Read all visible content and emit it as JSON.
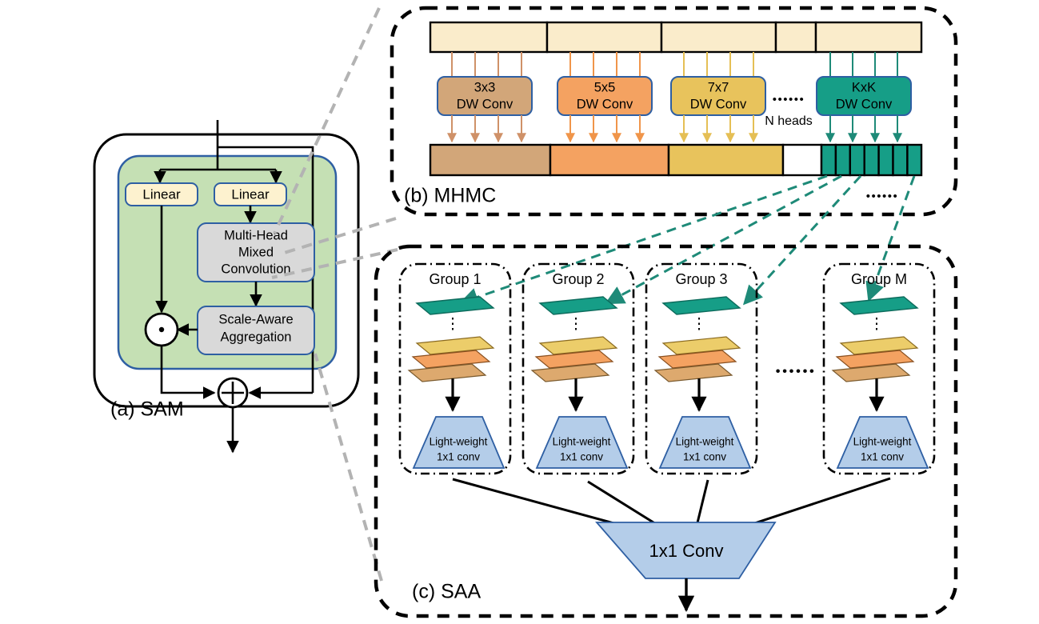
{
  "figure": {
    "title": "Scale-Aware Modulation architecture",
    "panels": [
      {
        "id": "a",
        "label": "(a) SAM"
      },
      {
        "id": "b",
        "label": "(b) MHMC"
      },
      {
        "id": "c",
        "label": "(c) SAA"
      }
    ]
  },
  "panel_a": {
    "label": "(a) SAM",
    "linear_left": "Linear",
    "linear_right": "Linear",
    "mhmc_block": "Multi-Head\nMixed\nConvolution",
    "mhmc_lines": [
      "Multi-Head",
      "Mixed",
      "Convolution"
    ],
    "saa_block": "Scale-Aware\nAggregation",
    "saa_lines": [
      "Scale-Aware",
      "Aggregation"
    ],
    "mul_symbol": "·",
    "add_symbol": "+",
    "colors": {
      "inner_fill": "#c5e0b4",
      "inner_stroke": "#2e5fa3",
      "linear_fill": "#fdf2cf",
      "gray_fill": "#d9d9d9",
      "outline": "#000000"
    }
  },
  "panel_b": {
    "label": "(b) MHMC",
    "heads": [
      {
        "kernel": "3x3",
        "op": "DW Conv",
        "color": "#d2a679"
      },
      {
        "kernel": "5x5",
        "op": "DW Conv",
        "color": "#f4a261"
      },
      {
        "kernel": "7x7",
        "op": "DW Conv",
        "color": "#e8c35c"
      },
      {
        "kernel": "KxK",
        "op": "DW Conv",
        "color": "#169e87"
      }
    ],
    "ellipsis_heads": "••••••",
    "n_heads_label": "N heads",
    "ellipsis_bottom": "••••••",
    "input_fill": "#faeccb",
    "teal_cells": 7,
    "output_segments": [
      {
        "color": "#d2a679"
      },
      {
        "color": "#f4a261"
      },
      {
        "color": "#e8c35c"
      },
      {
        "color": "#ffffff"
      },
      {
        "color": "#169e87"
      }
    ]
  },
  "panel_c": {
    "label": "(c) SAA",
    "groups": [
      {
        "title": "Group 1",
        "conv_line1": "Light-weight",
        "conv_line2": "1x1 conv"
      },
      {
        "title": "Group 2",
        "conv_line1": "Light-weight",
        "conv_line2": "1x1 conv"
      },
      {
        "title": "Group 3",
        "conv_line1": "Light-weight",
        "conv_line2": "1x1 conv"
      },
      {
        "title": "Group M",
        "conv_line1": "Light-weight",
        "conv_line2": "1x1 conv"
      }
    ],
    "group_ellipsis": "••••••",
    "final_conv": "1x1 Conv",
    "vertical_dots": "⋮",
    "colors": {
      "teal_map": "#169e87",
      "yellow_map": "#eccd6a",
      "orange_map": "#f4a261",
      "tan_map": "#dda96e",
      "conv_fill": "#b4cde9",
      "conv_stroke": "#2e5fa3"
    }
  },
  "connectors": {
    "gray": "#b3b3b3",
    "teal": "#1e8a78",
    "black": "#000000"
  }
}
